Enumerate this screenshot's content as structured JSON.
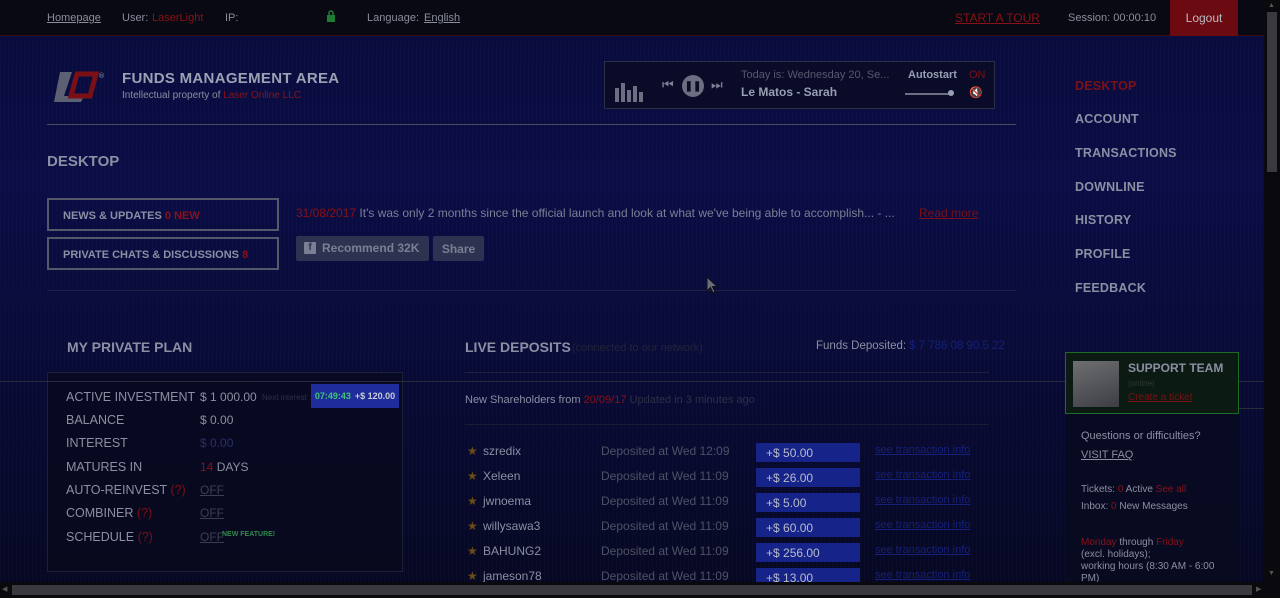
{
  "topbar": {
    "homepage": "Homepage",
    "user_label": "User:",
    "user_name": "LaserLight",
    "ip_label": "IP:",
    "language_label": "Language:",
    "language_value": "English",
    "start_tour": "START A TOUR",
    "session_label": "Session: 00:00:10",
    "logout": "Logout"
  },
  "header": {
    "title": "FUNDS MANAGEMENT AREA",
    "subtitle_prefix": "Intellectual property of ",
    "subtitle_company": "Laser Online LLC"
  },
  "player": {
    "today": "Today is: Wednesday 20, Se...",
    "song": "Le Matos - Sarah",
    "autostart_label": "Autostart",
    "autostart_value": "ON"
  },
  "nav": {
    "items": [
      "DESKTOP",
      "ACCOUNT",
      "TRANSACTIONS",
      "DOWNLINE",
      "HISTORY",
      "PROFILE",
      "FEEDBACK"
    ],
    "active": "DESKTOP"
  },
  "desktop": {
    "title": "DESKTOP",
    "news_label": "NEWS & UPDATES",
    "news_count": "0 NEW",
    "chats_label": "PRIVATE CHATS & DISCUSSIONS",
    "chats_count": "8",
    "news_date": "31/08/2017",
    "news_text": "It's was only 2 months since the official launch and look at what we've being able to accomplish... - ...",
    "read_more": "Read more",
    "recommend_label": "Recommend 32K",
    "share_label": "Share"
  },
  "plan": {
    "title": "MY PRIVATE PLAN",
    "rows": [
      {
        "label": "ACTIVE INVESTMENT",
        "value": "$ 1 000.00"
      },
      {
        "label": "BALANCE",
        "value": "$ 0.00"
      },
      {
        "label": "INTEREST",
        "value": "$ 0.00"
      },
      {
        "label": "MATURES IN",
        "value_num": "14",
        "value_unit": " DAYS"
      },
      {
        "label": "AUTO-REINVEST",
        "q": "(?)",
        "value": "OFF"
      },
      {
        "label": "COMBINER",
        "q": "(?)",
        "value": "OFF"
      },
      {
        "label": "SCHEDULE",
        "q": "(?)",
        "value": "OFF"
      }
    ],
    "next_label": "Next interest",
    "timer": "07:49:43",
    "timer_amount": "+$ 120.00",
    "new_feature": "NEW FEATURE!"
  },
  "deposits": {
    "title": "LIVE DEPOSITS",
    "subtitle": "(connected to our network)",
    "funds_label": "Funds Deposited:",
    "funds_value": "$ 7 786 08 90.5 22",
    "shareholders_prefix": "New Shareholders from",
    "shareholders_date": "20/09/17",
    "shareholders_suffix": "Updated in 3 minutes ago",
    "rows": [
      {
        "name": "szredix",
        "when": "Deposited at Wed 12:09",
        "amount": "+$ 50.00",
        "link": "see transaction info"
      },
      {
        "name": "Xeleen",
        "when": "Deposited at Wed 11:09",
        "amount": "+$ 26.00",
        "link": "see transaction info"
      },
      {
        "name": "jwnoema",
        "when": "Deposited at Wed 11:09",
        "amount": "+$ 5.00",
        "link": "see transaction info"
      },
      {
        "name": "willysawa3",
        "when": "Deposited at Wed 11:09",
        "amount": "+$ 60.00",
        "link": "see transaction info"
      },
      {
        "name": "BAHUNG2",
        "when": "Deposited at Wed 11:09",
        "amount": "+$ 256.00",
        "link": "see transaction info"
      },
      {
        "name": "jameson78",
        "when": "Deposited at Wed 11:09",
        "amount": "+$ 13.00",
        "link": "see transaction info"
      }
    ]
  },
  "support": {
    "title": "SUPPORT TEAM",
    "subtitle": "(online)",
    "create_ticket": "Create a ticket",
    "questions": "Questions or difficulties?",
    "visit_faq": "VISIT FAQ",
    "tickets_label": "Tickets:",
    "tickets_count": "0",
    "tickets_active": "Active",
    "tickets_seeall": "See all",
    "inbox_label": "Inbox:",
    "inbox_count": "0",
    "inbox_text": "New Messages",
    "hours_monday": "Monday",
    "hours_through": "through",
    "hours_friday": "Friday",
    "hours_line2": "(excl. holidays);",
    "hours_line3": "working hours (8:30 AM - 6:00",
    "hours_line4": "PM)"
  },
  "colors": {
    "accent_red": "#7a1015",
    "deposit_blue": "#16248a",
    "timer_green": "#43c27a"
  }
}
